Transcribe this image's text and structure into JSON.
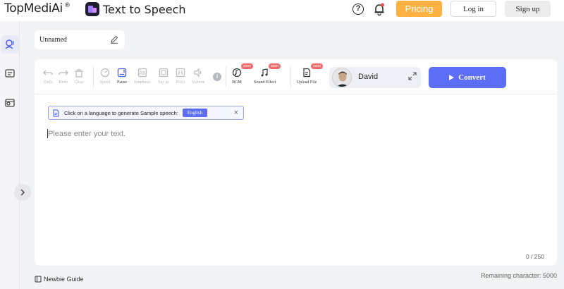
{
  "header": {
    "logo": "TopMediAi",
    "logo_mark": "®",
    "app_title": "Text to Speech",
    "pricing_label": "Pricing",
    "login_label": "Log in",
    "signup_label": "Sign up"
  },
  "sidebar": {
    "items": [
      {
        "name": "speech-icon",
        "active": true
      },
      {
        "name": "document-icon",
        "active": false
      },
      {
        "name": "media-icon",
        "active": false
      }
    ]
  },
  "document": {
    "name": "Unnamed"
  },
  "toolbar": {
    "undo": "Undo",
    "redo": "Redo",
    "clear": "Clear",
    "speed": "Speed",
    "pause": "Pause",
    "emphasis": "Emphasis",
    "say_as": "Say as",
    "pitch": "Pitch",
    "volume": "Volume",
    "bgm": "BGM",
    "sound_effect": "Sound Effect",
    "upload_file": "Upload File",
    "soon": "soon"
  },
  "voice": {
    "name": "David"
  },
  "convert_label": "Convert",
  "hint": {
    "text": "Click on a language to generate Sample speech:",
    "language": "English",
    "close": "×"
  },
  "editor": {
    "placeholder": "Please enter your text.",
    "count": "0 / 250"
  },
  "footer": {
    "newbie_guide": "Newbie Guide",
    "remaining": "Remaining character: 5000"
  },
  "colors": {
    "accent": "#5b6ef5",
    "pricing": "#ffb142",
    "soon_badge": "#f26b6b"
  }
}
